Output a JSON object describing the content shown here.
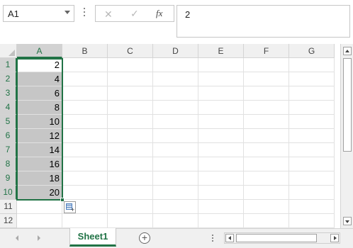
{
  "formula_bar": {
    "name_box": "A1",
    "cancel_icon": "close-icon",
    "enter_icon": "check-icon",
    "function_label": "fx",
    "formula_value": "2"
  },
  "columns": [
    "A",
    "B",
    "C",
    "D",
    "E",
    "F",
    "G"
  ],
  "rows": [
    "1",
    "2",
    "3",
    "4",
    "5",
    "6",
    "7",
    "8",
    "9",
    "10",
    "11",
    "12"
  ],
  "column_a_values": [
    "2",
    "4",
    "6",
    "8",
    "10",
    "12",
    "14",
    "16",
    "18",
    "20",
    "",
    ""
  ],
  "selection": {
    "range": "A1:A10",
    "active_cell": "A1"
  },
  "sheet_tabs": {
    "tabs": [
      "Sheet1"
    ],
    "active": "Sheet1",
    "add_icon": "plus-circle-icon"
  },
  "colors": {
    "accent": "#217346",
    "selection_fill": "#c6c6c6",
    "header_bg": "#f0f0f0",
    "gridline": "#e1e1e1"
  }
}
